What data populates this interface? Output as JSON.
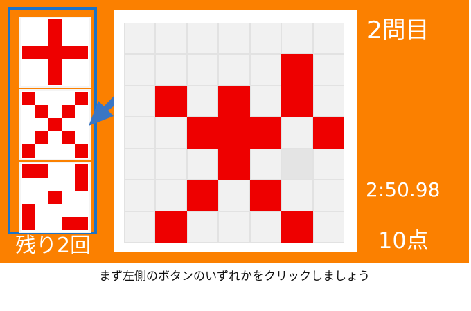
{
  "game": {
    "question_label": "2問目",
    "timer": "2:50.98",
    "score": "10点",
    "remaining": "残り2回",
    "instruction": "まず左側のボタンのいずれかをクリックしましょう"
  },
  "options": [
    {
      "name": "plus-pattern",
      "grid": [
        [
          0,
          0,
          1,
          0,
          0
        ],
        [
          0,
          0,
          1,
          0,
          0
        ],
        [
          1,
          1,
          1,
          1,
          1
        ],
        [
          0,
          0,
          1,
          0,
          0
        ],
        [
          0,
          0,
          1,
          0,
          0
        ]
      ]
    },
    {
      "name": "x-pattern",
      "grid": [
        [
          1,
          0,
          0,
          0,
          1
        ],
        [
          0,
          1,
          0,
          1,
          0
        ],
        [
          0,
          0,
          1,
          0,
          0
        ],
        [
          0,
          1,
          0,
          1,
          0
        ],
        [
          1,
          0,
          0,
          0,
          1
        ]
      ]
    },
    {
      "name": "corner-pattern",
      "grid": [
        [
          1,
          1,
          0,
          0,
          1
        ],
        [
          0,
          0,
          0,
          0,
          1
        ],
        [
          0,
          0,
          1,
          0,
          0
        ],
        [
          1,
          0,
          0,
          0,
          0
        ],
        [
          1,
          0,
          0,
          1,
          1
        ]
      ]
    }
  ],
  "board": {
    "grid": [
      [
        0,
        0,
        0,
        0,
        0,
        0,
        0
      ],
      [
        0,
        0,
        0,
        0,
        0,
        1,
        0
      ],
      [
        0,
        1,
        0,
        1,
        0,
        1,
        0
      ],
      [
        0,
        0,
        1,
        1,
        1,
        0,
        1
      ],
      [
        0,
        0,
        0,
        1,
        0,
        2,
        0
      ],
      [
        0,
        0,
        1,
        0,
        1,
        0,
        0
      ],
      [
        0,
        1,
        0,
        0,
        0,
        1,
        0
      ]
    ]
  },
  "colors": {
    "background": "#fb8000",
    "cell_on": "#ee0000",
    "selection_border": "#1a73c8",
    "arrow": "#3a76c4"
  },
  "icons": {
    "arrow": "arrow-icon"
  }
}
